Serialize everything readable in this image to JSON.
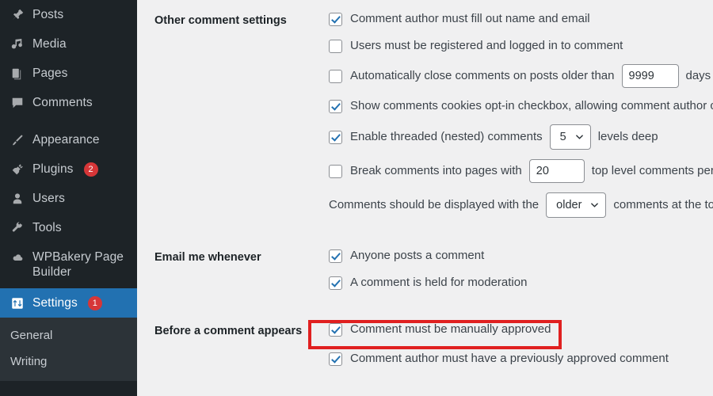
{
  "sidebar": {
    "items": [
      {
        "label": "Posts",
        "icon": "pin-icon",
        "badge": null,
        "current": false
      },
      {
        "label": "Media",
        "icon": "media-icon",
        "badge": null,
        "current": false
      },
      {
        "label": "Pages",
        "icon": "pages-icon",
        "badge": null,
        "current": false
      },
      {
        "label": "Comments",
        "icon": "comment-icon",
        "badge": null,
        "current": false
      },
      {
        "label": "Appearance",
        "icon": "brush-icon",
        "badge": null,
        "current": false
      },
      {
        "label": "Plugins",
        "icon": "plug-icon",
        "badge": "2",
        "current": false
      },
      {
        "label": "Users",
        "icon": "user-icon",
        "badge": null,
        "current": false
      },
      {
        "label": "Tools",
        "icon": "wrench-icon",
        "badge": null,
        "current": false
      },
      {
        "label": "WPBakery Page Builder",
        "icon": "cloud-icon",
        "badge": null,
        "current": false
      },
      {
        "label": "Settings",
        "icon": "settings-icon",
        "badge": "1",
        "current": true
      }
    ],
    "submenu": [
      {
        "label": "General",
        "active": false
      },
      {
        "label": "Writing",
        "active": false
      }
    ],
    "colors": {
      "background": "#1d2327",
      "submenu_background": "#2c3338",
      "current_item": "#2271b1",
      "badge": "#d63638"
    }
  },
  "main": {
    "accent": "#2271b1",
    "highlight_color": "#e02020",
    "sections": {
      "other_comment_settings": {
        "label": "Other comment settings",
        "options": [
          {
            "label": "Comment author must fill out name and email",
            "checked": true
          },
          {
            "label": "Users must be registered and logged in to comment",
            "checked": false
          },
          {
            "label_before": "Automatically close comments on posts older than",
            "value": "9999",
            "label_after": "days",
            "checked": false
          },
          {
            "label": "Show comments cookies opt-in checkbox, allowing comment author cookies to be set",
            "checked": true
          },
          {
            "label_before": "Enable threaded (nested) comments",
            "value": "5",
            "label_after": "levels deep",
            "checked": true
          },
          {
            "label_before": "Break comments into pages with",
            "value": "20",
            "label_after": "top level comments per page and the",
            "checked": false
          }
        ],
        "display_order": {
          "label_before": "Comments should be displayed with the",
          "value": "older",
          "label_after": "comments at the top of each page"
        }
      },
      "email_me_whenever": {
        "label": "Email me whenever",
        "options": [
          {
            "label": "Anyone posts a comment",
            "checked": true
          },
          {
            "label": "A comment is held for moderation",
            "checked": true
          }
        ]
      },
      "before_a_comment_appears": {
        "label": "Before a comment appears",
        "options": [
          {
            "label": "Comment must be manually approved",
            "checked": true,
            "highlighted": true
          },
          {
            "label": "Comment author must have a previously approved comment",
            "checked": true,
            "highlighted": false
          }
        ]
      }
    }
  }
}
